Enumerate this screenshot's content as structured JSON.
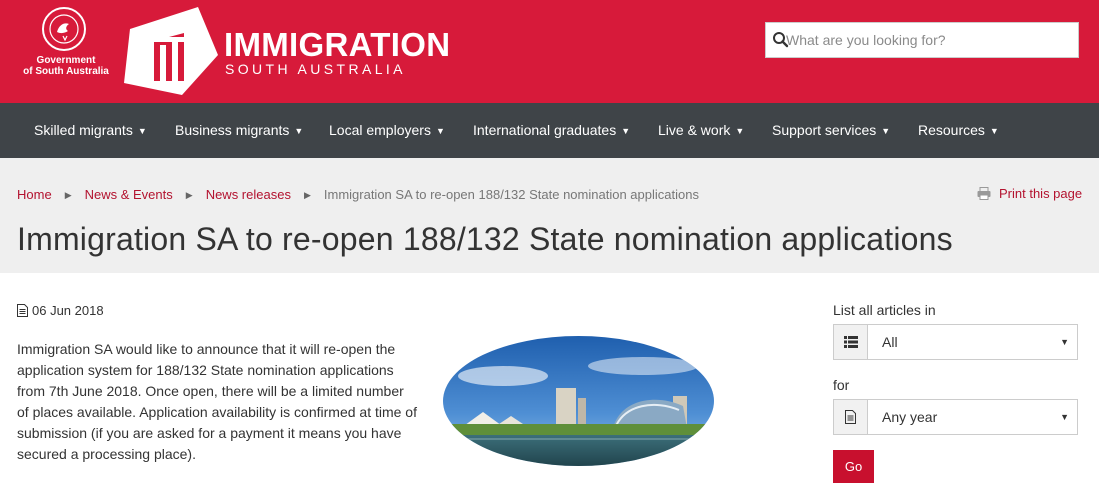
{
  "header": {
    "gov_logo_text_line1": "Government",
    "gov_logo_text_line2": "of South Australia",
    "crest_text": "SOUTH AUSTRALIA",
    "brand_title": "IMMIGRATION",
    "brand_subtitle": "SOUTH AUSTRALIA",
    "search_placeholder": "What are you looking for?",
    "colors": {
      "header_bg": "#d71a3a",
      "nav_bg": "#3f4448",
      "link": "#b3122f"
    }
  },
  "nav": {
    "items": [
      {
        "label": "Skilled migrants"
      },
      {
        "label": "Business migrants"
      },
      {
        "label": "Local employers"
      },
      {
        "label": "International graduates"
      },
      {
        "label": "Live & work"
      },
      {
        "label": "Support services"
      },
      {
        "label": "Resources"
      }
    ]
  },
  "breadcrumb": {
    "items": [
      "Home",
      "News & Events",
      "News releases"
    ],
    "current": "Immigration SA to re-open 188/132 State nomination applications"
  },
  "print_label": "Print this page",
  "page_title": "Immigration SA to re-open 188/132 State nomination applications",
  "article": {
    "date": "06 Jun 2018",
    "body": "Immigration SA would like to announce that it will re-open the application system for 188/132 State nomination applications from 7th June 2018. Once open, there will be a limited number of places available. Application availability is confirmed at time of submission (if you are asked for a payment it means you have secured a processing place)."
  },
  "sidebar": {
    "list_label": "List all articles in",
    "category_value": "All",
    "for_label": "for",
    "year_value": "Any year",
    "go_label": "Go"
  }
}
